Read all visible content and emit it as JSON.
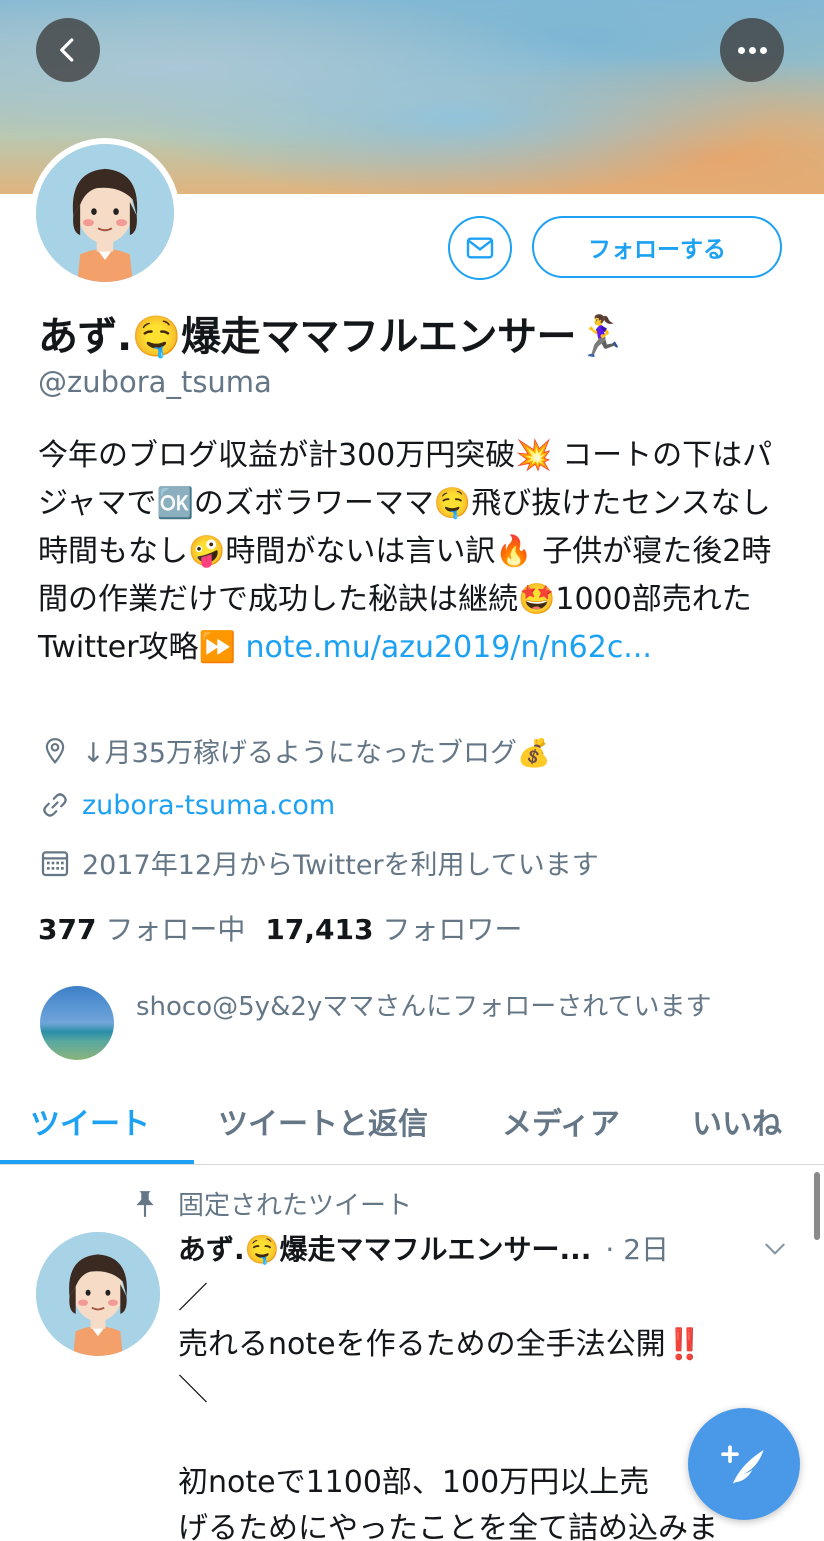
{
  "header": {
    "back_icon": "chevron-left-icon",
    "more_icon": "more-horizontal-icon"
  },
  "profile": {
    "display_name": "あず.🤤爆走ママフルエンサー🏃‍♀️",
    "handle": "@zubora_tsuma",
    "follow_label": "フォローする",
    "bio_text": "今年のブログ収益が計300万円突破💥 コートの下はパジャマで🆗のズボラワーママ🤤飛び抜けたセンスなし時間もなし🤪時間がないは言い訳🔥 子供が寝た後2時間の作業だけで成功した秘訣は継続🤩1000部売れたTwitter攻略⏩ ",
    "bio_link": "note.mu/azu2019/n/n62c...",
    "location": "↓月35万稼げるようになったブログ💰",
    "website": "zubora-tsuma.com",
    "joined": "2017年12月からTwitterを利用しています",
    "following_count": "377",
    "following_label": "フォロー中",
    "followers_count": "17,413",
    "followers_label": "フォロワー",
    "followed_by": "shoco@5y&2yママさんにフォローされています"
  },
  "tabs": [
    {
      "label": "ツイート",
      "active": true
    },
    {
      "label": "ツイートと返信",
      "active": false
    },
    {
      "label": "メディア",
      "active": false
    },
    {
      "label": "いいね",
      "active": false
    }
  ],
  "pinned_tweet": {
    "pinned_label": "固定されたツイート",
    "author": "あず.🤤爆走ママフルエンサー...",
    "time": "· 2日",
    "body": "／\n売れるnoteを作るための全手法公開‼️\n＼\n\n初noteで1100部、100万円以上売\nげるためにやったことを全て詰め込みま"
  },
  "colors": {
    "accent": "#1da1f2",
    "secondary_text": "#657786",
    "fab": "#4a99e9"
  },
  "icons": {
    "mail": "mail-icon",
    "location": "location-pin-icon",
    "link": "link-icon",
    "calendar": "calendar-icon",
    "pin": "pin-icon",
    "chevron": "chevron-down-icon",
    "compose": "compose-tweet-icon"
  }
}
